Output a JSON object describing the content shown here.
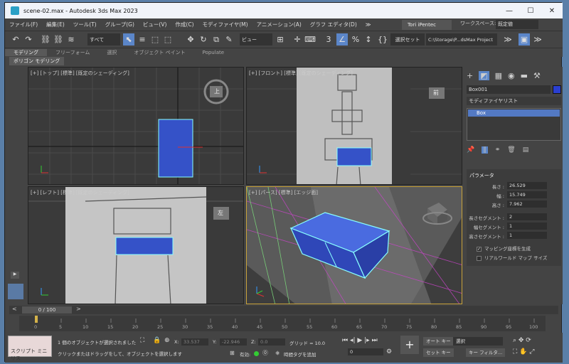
{
  "window": {
    "title": "scene-02.max - Autodesk 3ds Max 2023",
    "min": "—",
    "max": "☐",
    "close": "✕"
  },
  "menu": [
    "ファイル(F)",
    "編集(E)",
    "ツール(T)",
    "グループ(G)",
    "ビュー(V)",
    "作成(C)",
    "モディファイヤ(M)",
    "アニメーション(A)",
    "グラフ エディタ(D)",
    "≫"
  ],
  "user": "Tori iPentec",
  "workspace_label": "ワークスペース:",
  "workspace_value": "既定値",
  "toolbar": {
    "filter": "すべて",
    "view": "ビュー",
    "selset": "選択セット",
    "path": "C:\\Storage\\P...dsMax Project"
  },
  "ribbon": {
    "tabs": [
      "モデリング",
      "フリーフォーム",
      "選択",
      "オブジェクト ペイント",
      "Populate"
    ],
    "active": 0,
    "sub": "ポリゴン モデリング"
  },
  "viewports": {
    "top": "[+] [トップ] [標準] [既定のシェーディング]",
    "front": "[+] [フロント] [標準] [既定のシェーディング]",
    "left": "[+] [レフト] [標準] [既定のシェーディング]",
    "persp": "[+] [パース] [標準] [エッジ面]",
    "cube_top": "上",
    "cube_front": "前",
    "cube_left": "左"
  },
  "cmd": {
    "name": "Box001",
    "modlist": "モディファイヤリスト",
    "stack_item": "Box",
    "color": "#2a3fd0",
    "param_title": "パラメータ",
    "length_label": "長さ :",
    "length": "26.529",
    "width_label": "幅 :",
    "width": "15.749",
    "height_label": "高さ :",
    "height": "7.962",
    "lseg_label": "長さセグメント :",
    "lseg": "2",
    "wseg_label": "幅セグメント :",
    "wseg": "1",
    "hseg_label": "高さセグメント :",
    "hseg": "1",
    "gen_map": "マッピング座標を生成",
    "realworld": "リアルワールド マップ サイズ"
  },
  "timeline": {
    "slider": "0 / 100",
    "ticks": [
      "0",
      "5",
      "10",
      "15",
      "20",
      "25",
      "30",
      "35",
      "40",
      "45",
      "50",
      "55",
      "60",
      "65",
      "70",
      "75",
      "80",
      "85",
      "90",
      "95",
      "100"
    ]
  },
  "status": {
    "maxscript": "スクリプト ミニ リス",
    "sel": "1 個のオブジェクトが選択されました",
    "hint": "クリックまたはドラッグをして、オブジェクトを選択します",
    "x_label": "X:",
    "x": "33.537",
    "y_label": "Y:",
    "y": "-22.946",
    "z_label": "Z:",
    "z": "0.0",
    "grid": "グリッド = 10.0",
    "enabled": "有効:",
    "addtime": "時間タグを追加",
    "autokey": "オート キー",
    "setkey": "セット キー",
    "selmode": "選択",
    "keyfilter": "キー フィルタ...",
    "frame": "0"
  }
}
